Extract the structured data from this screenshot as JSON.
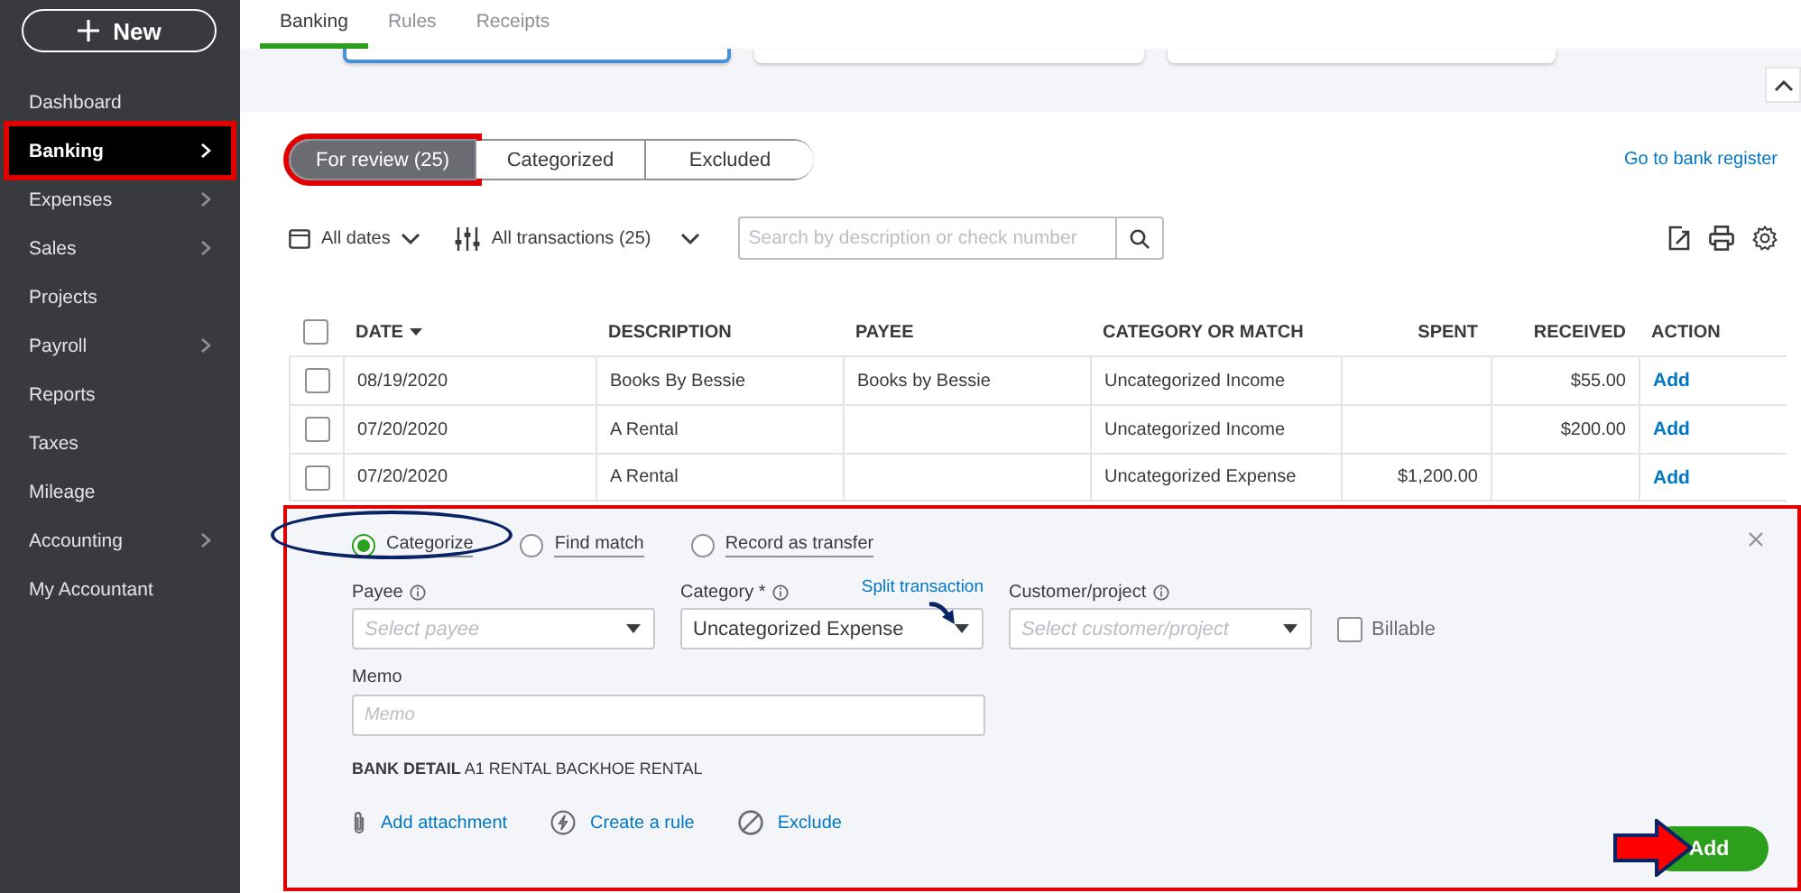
{
  "new_button": {
    "label": "New"
  },
  "sidebar": {
    "items": [
      {
        "label": "Dashboard",
        "selected": false,
        "has_submenu": false,
        "highlighted": false
      },
      {
        "label": "Banking",
        "selected": true,
        "has_submenu": true,
        "highlighted": true
      },
      {
        "label": "Expenses",
        "selected": false,
        "has_submenu": true,
        "highlighted": false
      },
      {
        "label": "Sales",
        "selected": false,
        "has_submenu": true,
        "highlighted": false
      },
      {
        "label": "Projects",
        "selected": false,
        "has_submenu": false,
        "highlighted": false
      },
      {
        "label": "Payroll",
        "selected": false,
        "has_submenu": true,
        "highlighted": false
      },
      {
        "label": "Reports",
        "selected": false,
        "has_submenu": false,
        "highlighted": false
      },
      {
        "label": "Taxes",
        "selected": false,
        "has_submenu": false,
        "highlighted": false
      },
      {
        "label": "Mileage",
        "selected": false,
        "has_submenu": false,
        "highlighted": false
      },
      {
        "label": "Accounting",
        "selected": false,
        "has_submenu": true,
        "highlighted": false
      },
      {
        "label": "My Accountant",
        "selected": false,
        "has_submenu": false,
        "highlighted": false
      }
    ]
  },
  "top_tabs": [
    {
      "label": "Banking",
      "selected": true
    },
    {
      "label": "Rules",
      "selected": false
    },
    {
      "label": "Receipts",
      "selected": false
    }
  ],
  "review_tabs": [
    {
      "label": "For review (25)",
      "selected": true,
      "highlighted": true
    },
    {
      "label": "Categorized",
      "selected": false,
      "highlighted": false
    },
    {
      "label": "Excluded",
      "selected": false,
      "highlighted": false
    }
  ],
  "register_link": "Go to bank register",
  "filters": {
    "date": "All dates",
    "transactions": "All transactions (25)",
    "search": {
      "placeholder": "Search by description or check number"
    }
  },
  "table": {
    "all_checked": false,
    "columns": [
      {
        "label": "DATE",
        "sorted": true
      },
      {
        "label": "DESCRIPTION",
        "sorted": false
      },
      {
        "label": "PAYEE",
        "sorted": false
      },
      {
        "label": "CATEGORY OR MATCH",
        "sorted": false
      },
      {
        "label": "SPENT",
        "sorted": false
      },
      {
        "label": "RECEIVED",
        "sorted": false
      },
      {
        "label": "ACTION",
        "sorted": false
      }
    ],
    "rows": [
      {
        "checked": false,
        "cells": [
          "08/19/2020",
          "Books By Bessie",
          "Books by Bessie",
          "Uncategorized Income",
          "",
          "$55.00"
        ],
        "action": "Add"
      },
      {
        "checked": false,
        "cells": [
          "07/20/2020",
          "A Rental",
          "",
          "Uncategorized Income",
          "",
          "$200.00"
        ],
        "action": "Add"
      },
      {
        "checked": false,
        "cells": [
          "07/20/2020",
          "A Rental",
          "",
          "Uncategorized Expense",
          "$1,200.00",
          ""
        ],
        "action": "Add"
      }
    ]
  },
  "detail_panel": {
    "highlighted": true,
    "modes": [
      {
        "label": "Categorize",
        "selected": true,
        "circled": true
      },
      {
        "label": "Find match",
        "selected": false,
        "circled": false
      },
      {
        "label": "Record as transfer",
        "selected": false,
        "circled": false
      }
    ],
    "fields": [
      {
        "label": "Payee",
        "placeholder": "Select payee"
      },
      {
        "label": "Category *",
        "value": "Uncategorized Expense",
        "link": "Split transaction"
      },
      {
        "label": "Customer/project",
        "placeholder": "Select customer/project"
      }
    ],
    "billable": {
      "label": "Billable",
      "checked": false
    },
    "memo": {
      "label": "Memo",
      "placeholder": "Memo"
    },
    "bank_detail": "**BANK DETAIL** A1 RENTAL BACKHOE RENTAL",
    "links": [
      {
        "label": "Add attachment",
        "kind": "attachment"
      },
      {
        "label": "Create a rule",
        "kind": "rule"
      },
      {
        "label": "Exclude",
        "kind": "exclude"
      }
    ],
    "add_button": "Add"
  }
}
